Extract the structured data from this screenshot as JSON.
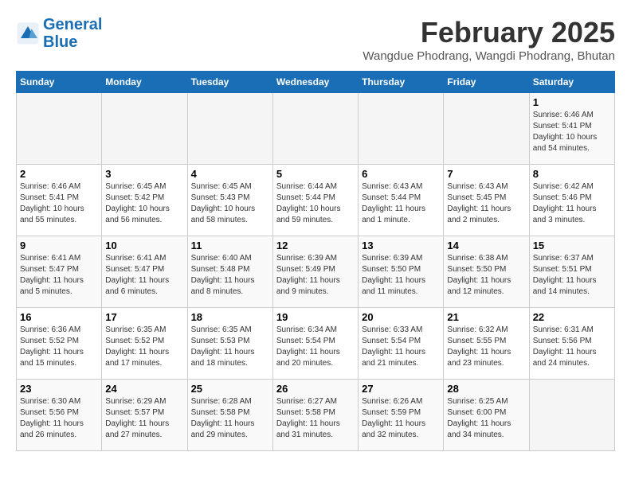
{
  "header": {
    "logo_line1": "General",
    "logo_line2": "Blue",
    "month_year": "February 2025",
    "location": "Wangdue Phodrang, Wangdi Phodrang, Bhutan"
  },
  "days_of_week": [
    "Sunday",
    "Monday",
    "Tuesday",
    "Wednesday",
    "Thursday",
    "Friday",
    "Saturday"
  ],
  "weeks": [
    [
      {
        "day": "",
        "text": ""
      },
      {
        "day": "",
        "text": ""
      },
      {
        "day": "",
        "text": ""
      },
      {
        "day": "",
        "text": ""
      },
      {
        "day": "",
        "text": ""
      },
      {
        "day": "",
        "text": ""
      },
      {
        "day": "1",
        "text": "Sunrise: 6:46 AM\nSunset: 5:41 PM\nDaylight: 10 hours and 54 minutes."
      }
    ],
    [
      {
        "day": "2",
        "text": "Sunrise: 6:46 AM\nSunset: 5:41 PM\nDaylight: 10 hours and 55 minutes."
      },
      {
        "day": "3",
        "text": "Sunrise: 6:45 AM\nSunset: 5:42 PM\nDaylight: 10 hours and 56 minutes."
      },
      {
        "day": "4",
        "text": "Sunrise: 6:45 AM\nSunset: 5:43 PM\nDaylight: 10 hours and 58 minutes."
      },
      {
        "day": "5",
        "text": "Sunrise: 6:44 AM\nSunset: 5:44 PM\nDaylight: 10 hours and 59 minutes."
      },
      {
        "day": "6",
        "text": "Sunrise: 6:43 AM\nSunset: 5:44 PM\nDaylight: 11 hours and 1 minute."
      },
      {
        "day": "7",
        "text": "Sunrise: 6:43 AM\nSunset: 5:45 PM\nDaylight: 11 hours and 2 minutes."
      },
      {
        "day": "8",
        "text": "Sunrise: 6:42 AM\nSunset: 5:46 PM\nDaylight: 11 hours and 3 minutes."
      }
    ],
    [
      {
        "day": "9",
        "text": "Sunrise: 6:41 AM\nSunset: 5:47 PM\nDaylight: 11 hours and 5 minutes."
      },
      {
        "day": "10",
        "text": "Sunrise: 6:41 AM\nSunset: 5:47 PM\nDaylight: 11 hours and 6 minutes."
      },
      {
        "day": "11",
        "text": "Sunrise: 6:40 AM\nSunset: 5:48 PM\nDaylight: 11 hours and 8 minutes."
      },
      {
        "day": "12",
        "text": "Sunrise: 6:39 AM\nSunset: 5:49 PM\nDaylight: 11 hours and 9 minutes."
      },
      {
        "day": "13",
        "text": "Sunrise: 6:39 AM\nSunset: 5:50 PM\nDaylight: 11 hours and 11 minutes."
      },
      {
        "day": "14",
        "text": "Sunrise: 6:38 AM\nSunset: 5:50 PM\nDaylight: 11 hours and 12 minutes."
      },
      {
        "day": "15",
        "text": "Sunrise: 6:37 AM\nSunset: 5:51 PM\nDaylight: 11 hours and 14 minutes."
      }
    ],
    [
      {
        "day": "16",
        "text": "Sunrise: 6:36 AM\nSunset: 5:52 PM\nDaylight: 11 hours and 15 minutes."
      },
      {
        "day": "17",
        "text": "Sunrise: 6:35 AM\nSunset: 5:52 PM\nDaylight: 11 hours and 17 minutes."
      },
      {
        "day": "18",
        "text": "Sunrise: 6:35 AM\nSunset: 5:53 PM\nDaylight: 11 hours and 18 minutes."
      },
      {
        "day": "19",
        "text": "Sunrise: 6:34 AM\nSunset: 5:54 PM\nDaylight: 11 hours and 20 minutes."
      },
      {
        "day": "20",
        "text": "Sunrise: 6:33 AM\nSunset: 5:54 PM\nDaylight: 11 hours and 21 minutes."
      },
      {
        "day": "21",
        "text": "Sunrise: 6:32 AM\nSunset: 5:55 PM\nDaylight: 11 hours and 23 minutes."
      },
      {
        "day": "22",
        "text": "Sunrise: 6:31 AM\nSunset: 5:56 PM\nDaylight: 11 hours and 24 minutes."
      }
    ],
    [
      {
        "day": "23",
        "text": "Sunrise: 6:30 AM\nSunset: 5:56 PM\nDaylight: 11 hours and 26 minutes."
      },
      {
        "day": "24",
        "text": "Sunrise: 6:29 AM\nSunset: 5:57 PM\nDaylight: 11 hours and 27 minutes."
      },
      {
        "day": "25",
        "text": "Sunrise: 6:28 AM\nSunset: 5:58 PM\nDaylight: 11 hours and 29 minutes."
      },
      {
        "day": "26",
        "text": "Sunrise: 6:27 AM\nSunset: 5:58 PM\nDaylight: 11 hours and 31 minutes."
      },
      {
        "day": "27",
        "text": "Sunrise: 6:26 AM\nSunset: 5:59 PM\nDaylight: 11 hours and 32 minutes."
      },
      {
        "day": "28",
        "text": "Sunrise: 6:25 AM\nSunset: 6:00 PM\nDaylight: 11 hours and 34 minutes."
      },
      {
        "day": "",
        "text": ""
      }
    ]
  ]
}
